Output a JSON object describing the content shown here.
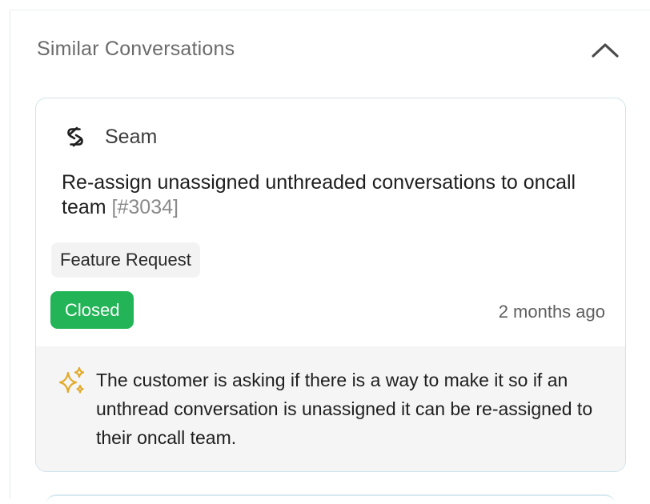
{
  "section": {
    "title": "Similar Conversations"
  },
  "card": {
    "company_name": "Seam",
    "title_text": "Re-assign unassigned unthreaded conversations to oncall team",
    "conversation_id": "[#3034]",
    "tag": "Feature Request",
    "status": "Closed",
    "timestamp": "2 months ago",
    "summary": "The customer is asking if there is a way to make it so if an unthread conversation is unassigned it can be re-assigned to their oncall team."
  },
  "icons": {
    "collapse": "chevron-up-icon",
    "company_logo": "seam-logo-icon",
    "summary": "sparkle-icon"
  },
  "colors": {
    "status_closed": "#22b456",
    "card_border": "#cfe3ea",
    "summary_bg": "#f5f5f6",
    "sparkle": "#e2aa2a"
  }
}
